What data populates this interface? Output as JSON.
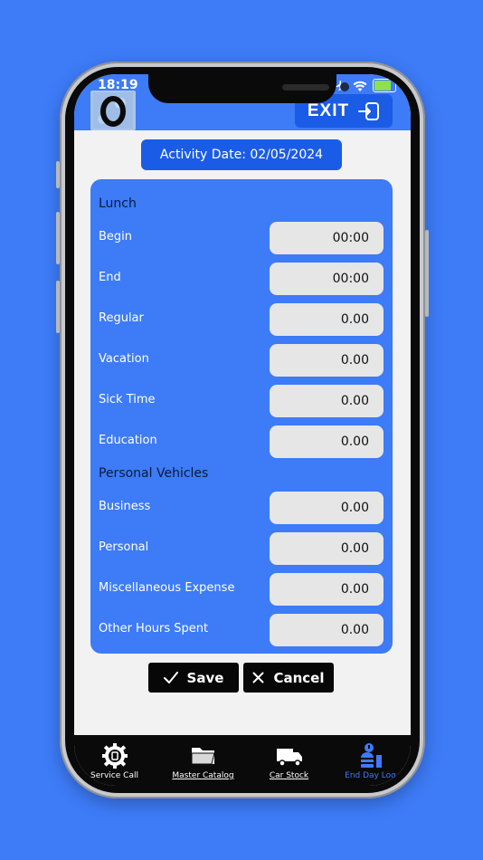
{
  "status_bar": {
    "time": "18:19"
  },
  "header": {
    "exit_label": "EXIT"
  },
  "activity_date": "Activity Date: 02/05/2024",
  "sections": {
    "lunch_title": "Lunch",
    "vehicles_title": "Personal Vehicles"
  },
  "rows": [
    {
      "label": "Begin",
      "value": "00:00"
    },
    {
      "label": "End",
      "value": "00:00"
    },
    {
      "label": "Regular",
      "value": "0.00"
    },
    {
      "label": "Vacation",
      "value": "0.00"
    },
    {
      "label": "Sick Time",
      "value": "0.00"
    },
    {
      "label": "Education",
      "value": "0.00"
    },
    {
      "label": "Business",
      "value": "0.00"
    },
    {
      "label": "Personal",
      "value": "0.00"
    },
    {
      "label": "Miscellaneous Expense",
      "value": "0.00"
    },
    {
      "label": "Other Hours Spent",
      "value": "0.00"
    }
  ],
  "actions": {
    "save_label": "Save",
    "cancel_label": "Cancel"
  },
  "nav": [
    {
      "label": "Service Call",
      "icon": "service-gear-icon"
    },
    {
      "label": "Master Catalog",
      "icon": "folder-icon"
    },
    {
      "label": "Car Stock",
      "icon": "truck-icon"
    },
    {
      "label": "End Day Log",
      "icon": "end-day-log-icon"
    }
  ],
  "colors": {
    "primary": "#3d7bf7",
    "accent": "#1a5ce6",
    "field": "#e6e6e6",
    "nav_bg": "#0a0a0a"
  }
}
